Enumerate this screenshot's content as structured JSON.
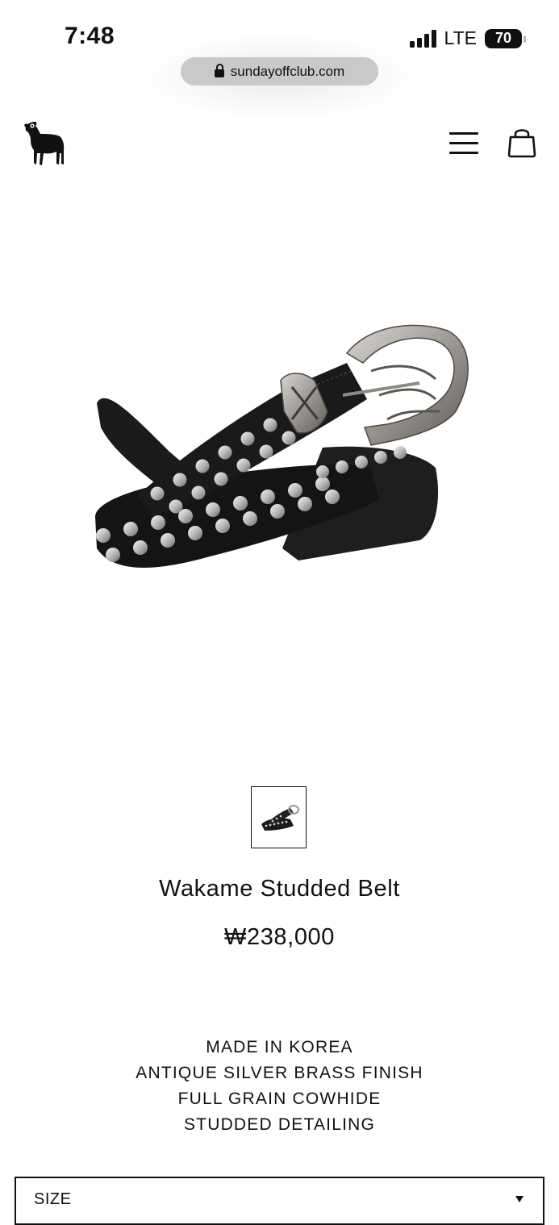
{
  "status_bar": {
    "time": "7:48",
    "network": "LTE",
    "battery": "70",
    "signal_bars": 4
  },
  "browser": {
    "url": "sundayoffclub.com"
  },
  "header": {
    "logo_icon": "lamb-logo-icon",
    "menu_icon": "hamburger-menu-icon",
    "cart_icon": "shopping-bag-icon"
  },
  "product": {
    "title": "Wakame Studded Belt",
    "price": "₩238,000",
    "details": [
      "MADE IN KOREA",
      "ANTIQUE SILVER BRASS FINISH",
      "FULL GRAIN COWHIDE",
      "STUDDED DETAILING"
    ],
    "size_select": {
      "label": "SIZE"
    }
  },
  "colors": {
    "text": "#111111",
    "background": "#ffffff",
    "url_pill": "#c9c9c9"
  }
}
